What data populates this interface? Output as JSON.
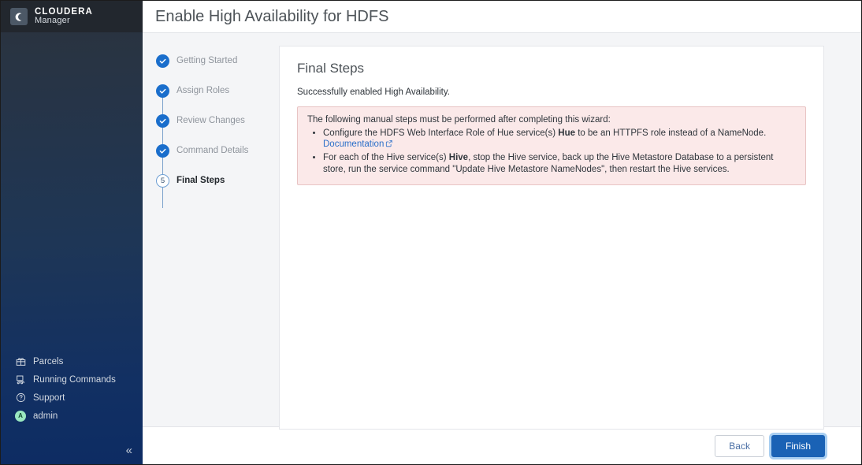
{
  "sidebar": {
    "brand": {
      "title": "CLOUDERA",
      "subtitle": "Manager",
      "logo_icon": "cloudera-c-logo"
    },
    "nav": [
      {
        "label": "Parcels",
        "icon": "parcels-box-icon"
      },
      {
        "label": "Running Commands",
        "icon": "running-commands-icon"
      },
      {
        "label": "Support",
        "icon": "support-question-icon"
      },
      {
        "label": "admin",
        "icon": "user-avatar",
        "avatar_initial": "A"
      }
    ],
    "collapse_glyph": "«",
    "colors": {
      "top": "#2b323c",
      "bottom": "#0d2c63",
      "avatar": "#9ae8c0"
    }
  },
  "header": {
    "title": "Enable High Availability for HDFS"
  },
  "steps": [
    {
      "label": "Getting Started",
      "state": "complete"
    },
    {
      "label": "Assign Roles",
      "state": "complete"
    },
    {
      "label": "Review Changes",
      "state": "complete"
    },
    {
      "label": "Command Details",
      "state": "complete"
    },
    {
      "label": "Final Steps",
      "state": "current",
      "number": "5"
    }
  ],
  "main": {
    "title": "Final Steps",
    "subtitle": "Successfully enabled High Availability.",
    "alert": {
      "lead": "The following manual steps must be performed after completing this wizard:",
      "bullets": [
        {
          "part1": "Configure the HDFS Web Interface Role of Hue service(s) ",
          "bold1": "Hue",
          "part2": " to be an HTTPFS role instead of a NameNode. ",
          "link": "Documentation",
          "link_icon": "external-link-icon"
        },
        {
          "part1": "For each of the Hive service(s) ",
          "bold1": "Hive",
          "part2": ", stop the Hive service, back up the Hive Metastore Database to a persistent store, run the service command \"Update Hive Metastore NameNodes\", then restart the Hive services."
        }
      ],
      "colors": {
        "background": "#fbe9e9",
        "border": "#e8c4c4",
        "link": "#2a6fc9"
      }
    }
  },
  "footer": {
    "back_label": "Back",
    "finish_label": "Finish",
    "finish_color": "#1a62b5"
  }
}
